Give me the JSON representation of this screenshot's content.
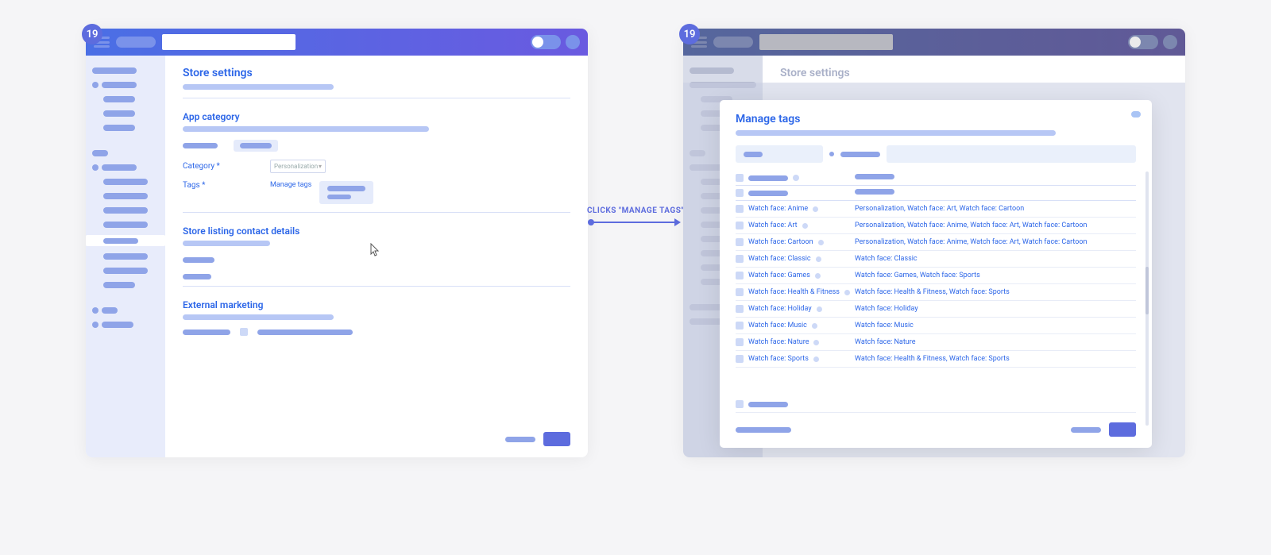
{
  "step_badge": "19",
  "arrow_label": "CLICKS \"MANAGE TAGS\"",
  "left": {
    "page_title": "Store settings",
    "section_app_category": "App category",
    "field_category": "Category *",
    "category_value": "Personalization",
    "field_tags": "Tags *",
    "manage_tags_link": "Manage tags",
    "section_contact": "Store listing contact details",
    "section_marketing": "External marketing"
  },
  "right": {
    "page_title_dimmed": "Store settings",
    "modal_title": "Manage tags",
    "rows": [
      {
        "tag": "Watch face: Anime",
        "suggest": "Personalization, Watch face: Art, Watch face: Cartoon"
      },
      {
        "tag": "Watch face: Art",
        "suggest": "Personalization, Watch face: Anime, Watch face: Art, Watch face: Cartoon"
      },
      {
        "tag": "Watch face: Cartoon",
        "suggest": "Personalization, Watch face: Anime, Watch face: Art, Watch face: Cartoon"
      },
      {
        "tag": "Watch face: Classic",
        "suggest": "Watch face: Classic"
      },
      {
        "tag": "Watch face: Games",
        "suggest": "Watch face: Games, Watch face: Sports"
      },
      {
        "tag": "Watch face: Health & Fitness",
        "suggest": "Watch face: Health & Fitness, Watch face: Sports"
      },
      {
        "tag": "Watch face: Holiday",
        "suggest": "Watch face: Holiday"
      },
      {
        "tag": "Watch face: Music",
        "suggest": "Watch face: Music"
      },
      {
        "tag": "Watch face: Nature",
        "suggest": "Watch face: Nature"
      },
      {
        "tag": "Watch face: Sports",
        "suggest": "Watch face: Health & Fitness, Watch face: Sports"
      }
    ]
  }
}
